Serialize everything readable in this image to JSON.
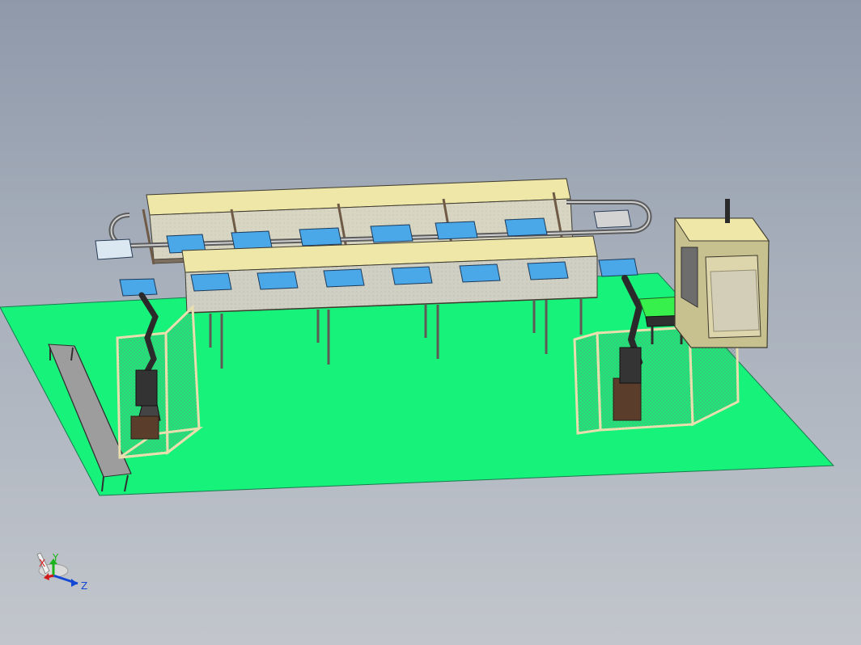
{
  "viewer": {
    "title": ""
  },
  "triad": {
    "x_label": "X",
    "y_label": "Y",
    "z_label": "Z",
    "x_color": "#d11a1a",
    "y_color": "#1bb51b",
    "z_color": "#1447d4"
  },
  "colors": {
    "background_top": "#8f99aa",
    "background_bottom": "#c2c6cc",
    "floor": "#17f27a",
    "frame_beige": "#efe7a8",
    "frame_outline": "#3e3b2f",
    "tray_blue": "#4aa7e8",
    "robot_dark": "#2a2a2a",
    "guard_frame": "#e8dfae",
    "guard_mesh": "#7d7d7d",
    "green_pad": "#38f04b",
    "machine_body": "#c7c08f"
  }
}
